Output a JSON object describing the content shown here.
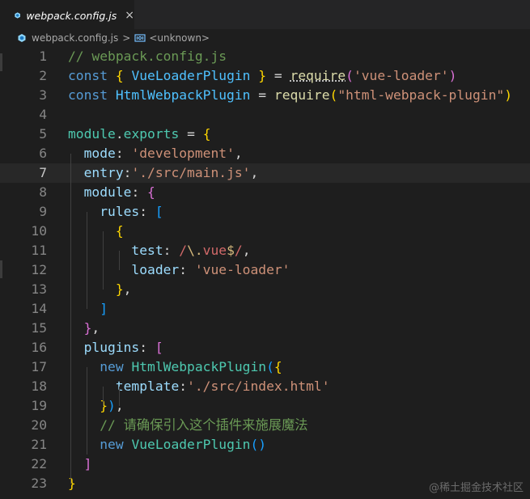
{
  "tab": {
    "title": "webpack.config.js",
    "close_glyph": "×"
  },
  "breadcrumbs": {
    "file": "webpack.config.js",
    "separator": ">",
    "symbol": "<unknown>"
  },
  "editor": {
    "current_line": 7,
    "lines": [
      {
        "num": "1",
        "tokens": [
          [
            "c-com",
            "// webpack.config.js"
          ]
        ]
      },
      {
        "num": "2",
        "tokens": [
          [
            "c-kw",
            "const "
          ],
          [
            "c-b1",
            "{ "
          ],
          [
            "c-var",
            "VueLoaderPlugin"
          ],
          [
            "c-b1",
            " }"
          ],
          [
            "c-op",
            " = "
          ],
          [
            "c-fn dotted",
            "require"
          ],
          [
            "c-b2",
            "("
          ],
          [
            "c-str",
            "'vue-loader'"
          ],
          [
            "c-b2",
            ")"
          ]
        ]
      },
      {
        "num": "3",
        "tokens": [
          [
            "c-kw",
            "const "
          ],
          [
            "c-var",
            "HtmlWebpackPlugin"
          ],
          [
            "c-op",
            " = "
          ],
          [
            "c-fn",
            "require"
          ],
          [
            "c-b1",
            "("
          ],
          [
            "c-str",
            "\"html-webpack-plugin\""
          ],
          [
            "c-b1",
            ")"
          ]
        ]
      },
      {
        "num": "4",
        "tokens": []
      },
      {
        "num": "5",
        "tokens": [
          [
            "c-cls",
            "module"
          ],
          [
            "c-op",
            "."
          ],
          [
            "c-cls",
            "exports"
          ],
          [
            "c-op",
            " = "
          ],
          [
            "c-b1",
            "{"
          ]
        ]
      },
      {
        "num": "6",
        "tokens": [
          [
            "c-def",
            "  "
          ],
          [
            "c-prop",
            "mode"
          ],
          [
            "c-op",
            ": "
          ],
          [
            "c-str",
            "'development'"
          ],
          [
            "c-op",
            ","
          ]
        ]
      },
      {
        "num": "7",
        "tokens": [
          [
            "c-def",
            "  "
          ],
          [
            "c-prop",
            "entry"
          ],
          [
            "c-op",
            ":"
          ],
          [
            "c-str",
            "'./src/main.js'"
          ],
          [
            "c-op",
            ","
          ]
        ]
      },
      {
        "num": "8",
        "tokens": [
          [
            "c-def",
            "  "
          ],
          [
            "c-prop",
            "module"
          ],
          [
            "c-op",
            ": "
          ],
          [
            "c-b2",
            "{"
          ]
        ]
      },
      {
        "num": "9",
        "tokens": [
          [
            "c-def",
            "    "
          ],
          [
            "c-prop",
            "rules"
          ],
          [
            "c-op",
            ": "
          ],
          [
            "c-b3",
            "["
          ]
        ]
      },
      {
        "num": "10",
        "tokens": [
          [
            "c-def",
            "      "
          ],
          [
            "c-b1",
            "{"
          ]
        ]
      },
      {
        "num": "11",
        "tokens": [
          [
            "c-def",
            "        "
          ],
          [
            "c-prop",
            "test"
          ],
          [
            "c-op",
            ": "
          ],
          [
            "c-re",
            "/"
          ],
          [
            "c-rex",
            "\\."
          ],
          [
            "c-re",
            "vue"
          ],
          [
            "c-rex",
            "$"
          ],
          [
            "c-re",
            "/"
          ],
          [
            "c-op",
            ","
          ]
        ]
      },
      {
        "num": "12",
        "tokens": [
          [
            "c-def",
            "        "
          ],
          [
            "c-prop",
            "loader"
          ],
          [
            "c-op",
            ": "
          ],
          [
            "c-str",
            "'vue-loader'"
          ]
        ]
      },
      {
        "num": "13",
        "tokens": [
          [
            "c-def",
            "      "
          ],
          [
            "c-b1",
            "}"
          ],
          [
            "c-op",
            ","
          ]
        ]
      },
      {
        "num": "14",
        "tokens": [
          [
            "c-def",
            "    "
          ],
          [
            "c-b3",
            "]"
          ]
        ]
      },
      {
        "num": "15",
        "tokens": [
          [
            "c-def",
            "  "
          ],
          [
            "c-b2",
            "}"
          ],
          [
            "c-op",
            ","
          ]
        ]
      },
      {
        "num": "16",
        "tokens": [
          [
            "c-def",
            "  "
          ],
          [
            "c-prop",
            "plugins"
          ],
          [
            "c-op",
            ": "
          ],
          [
            "c-b2",
            "["
          ]
        ]
      },
      {
        "num": "17",
        "tokens": [
          [
            "c-def",
            "    "
          ],
          [
            "c-kw",
            "new "
          ],
          [
            "c-cls",
            "HtmlWebpackPlugin"
          ],
          [
            "c-b3",
            "("
          ],
          [
            "c-b1",
            "{"
          ]
        ]
      },
      {
        "num": "18",
        "tokens": [
          [
            "c-def",
            "      "
          ],
          [
            "c-prop",
            "template"
          ],
          [
            "c-op",
            ":"
          ],
          [
            "c-str",
            "'./src/index.html'"
          ]
        ]
      },
      {
        "num": "19",
        "tokens": [
          [
            "c-def",
            "    "
          ],
          [
            "c-b1",
            "}"
          ],
          [
            "c-b3",
            ")"
          ],
          [
            "c-op",
            ","
          ]
        ]
      },
      {
        "num": "20",
        "tokens": [
          [
            "c-def",
            "    "
          ],
          [
            "c-com",
            "// 请确保引入这个插件来施展魔法"
          ]
        ]
      },
      {
        "num": "21",
        "tokens": [
          [
            "c-def",
            "    "
          ],
          [
            "c-kw",
            "new "
          ],
          [
            "c-cls",
            "VueLoaderPlugin"
          ],
          [
            "c-b3",
            "()"
          ]
        ]
      },
      {
        "num": "22",
        "tokens": [
          [
            "c-def",
            "  "
          ],
          [
            "c-b2",
            "]"
          ]
        ]
      },
      {
        "num": "23",
        "tokens": [
          [
            "c-b1",
            "}"
          ]
        ]
      }
    ]
  },
  "watermark": "@稀土掘金技术社区",
  "colors": {
    "background": "#1e1e1e",
    "tabbar": "#252526",
    "comment": "#6a9955",
    "keyword": "#569cd6",
    "string": "#ce9178"
  }
}
